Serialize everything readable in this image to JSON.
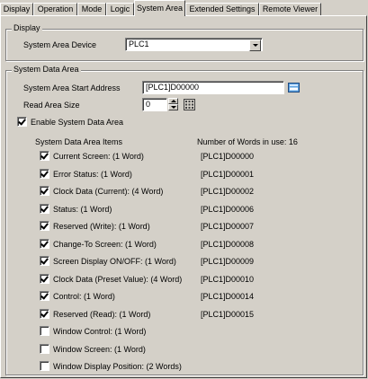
{
  "tabs": [
    {
      "label": "Display",
      "active": false
    },
    {
      "label": "Operation",
      "active": false
    },
    {
      "label": "Mode",
      "active": false
    },
    {
      "label": "Logic",
      "active": false
    },
    {
      "label": "System Area",
      "active": true
    },
    {
      "label": "Extended Settings",
      "active": false
    },
    {
      "label": "Remote Viewer",
      "active": false
    }
  ],
  "display": {
    "group_title": "Display",
    "device_label": "System Area Device",
    "device_value": "PLC1"
  },
  "system_data_area": {
    "group_title": "System Data Area",
    "start_address_label": "System Area Start Address",
    "start_address_value": "[PLC1]D00000",
    "read_area_label": "Read Area Size",
    "read_area_value": "0",
    "enable_label": "Enable System Data Area",
    "enable_checked": true,
    "items_header": "System Data Area Items",
    "words_in_use": "Number of Words in use: 16",
    "items": [
      {
        "label": "Current Screen: (1 Word)",
        "checked": true,
        "address": "[PLC1]D00000"
      },
      {
        "label": "Error Status: (1 Word)",
        "checked": true,
        "address": "[PLC1]D00001"
      },
      {
        "label": "Clock Data (Current): (4 Word)",
        "checked": true,
        "address": "[PLC1]D00002"
      },
      {
        "label": "Status: (1 Word)",
        "checked": true,
        "address": "[PLC1]D00006"
      },
      {
        "label": "Reserved (Write): (1 Word)",
        "checked": true,
        "address": "[PLC1]D00007"
      },
      {
        "label": "Change-To Screen: (1 Word)",
        "checked": true,
        "address": "[PLC1]D00008"
      },
      {
        "label": "Screen Display ON/OFF: (1 Word)",
        "checked": true,
        "address": "[PLC1]D00009"
      },
      {
        "label": "Clock Data (Preset Value): (4 Word)",
        "checked": true,
        "address": "[PLC1]D00010"
      },
      {
        "label": "Control: (1 Word)",
        "checked": true,
        "address": "[PLC1]D00014"
      },
      {
        "label": "Reserved (Read): (1 Word)",
        "checked": true,
        "address": "[PLC1]D00015"
      },
      {
        "label": "Window Control: (1 Word)",
        "checked": false,
        "address": ""
      },
      {
        "label": "Window Screen: (1 Word)",
        "checked": false,
        "address": ""
      },
      {
        "label": "Window Display Position: (2 Words)",
        "checked": false,
        "address": ""
      }
    ]
  }
}
